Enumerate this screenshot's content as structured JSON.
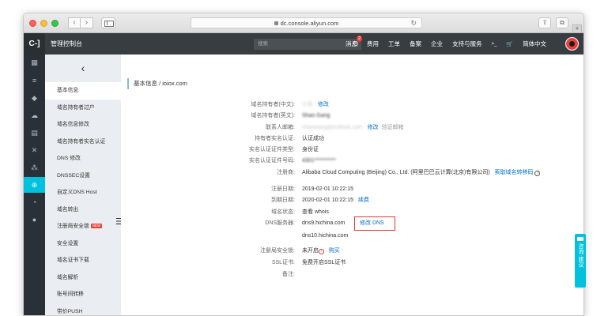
{
  "browser": {
    "url": "dc.console.aliyun.com",
    "back_icon": "‹",
    "forward_icon": "›",
    "reload_icon": "↻",
    "share_icon": "⇧",
    "tabs_icon": "⧉",
    "new_tab_icon": "+"
  },
  "topnav": {
    "logo": "C‑]",
    "title": "管理控制台",
    "search_placeholder": "搜索",
    "items": [
      {
        "label": "消息",
        "badge": "2"
      },
      {
        "label": "费用"
      },
      {
        "label": "工单"
      },
      {
        "label": "备案"
      },
      {
        "label": "企业"
      },
      {
        "label": "支持与服务"
      }
    ],
    "terminal_icon": ">_",
    "cart_icon": "🛒",
    "language": "简体中文"
  },
  "sidebar": {
    "back_icon": "‹",
    "items": [
      {
        "label": "基本信息",
        "active": true
      },
      {
        "label": "域名持有者过户"
      },
      {
        "label": "域名信息修改"
      },
      {
        "label": "域名持有者实名认证"
      },
      {
        "label": "DNS 修改"
      },
      {
        "label": "DNSSEC设置"
      },
      {
        "label": "自定义DNS Host"
      },
      {
        "label": "域名转出"
      },
      {
        "label": "注册局安全锁",
        "tag": "NEW"
      },
      {
        "label": "安全设置"
      },
      {
        "label": "域名证书下载"
      },
      {
        "label": "域名解析"
      },
      {
        "label": "账号间转移"
      },
      {
        "label": "带价PUSH"
      }
    ]
  },
  "breadcrumb": "基本信息 / ioiox.com",
  "details": {
    "owner_cn_label": "域名持有者(中文):",
    "owner_cn_value": "小灰",
    "modify": "修改",
    "owner_en_label": "域名持有者(英文):",
    "owner_en_value": "Shao Gang",
    "email_label": "联系人邮箱:",
    "email_value": "shaoxiang@outlook.com",
    "verify_email": "验证邮箱",
    "realname_label": "持有者实名认证:",
    "realname_value": "认证成功",
    "cert_type_label": "实名认证证件类型:",
    "cert_type_value": "身份证",
    "cert_no_label": "实名认证证件号码:",
    "cert_no_value": "4301**********",
    "registrar_label": "注册商:",
    "registrar_value": "Alibaba Cloud Computing (Beijing) Co., Ltd. (阿里巴巴云计算(北京)有限公司)",
    "auth_code": "索取域名转移码",
    "reg_date_label": "注册日期:",
    "reg_date_value": "2019-02-01 10:22:15",
    "exp_date_label": "到期日期:",
    "exp_date_value": "2020-02-01 10:22:15",
    "renew": "续费",
    "status_label": "域名状态:",
    "status_value": "查看 whois",
    "dns_label": "DNS服务器:",
    "dns1": "dns9.hichina.com",
    "dns2": "dns10.hichina.com",
    "modify_dns": "修改 DNS",
    "lock_label": "注册局安全锁:",
    "lock_value": "未开启",
    "buy": "购买",
    "ssl_label": "SSL证书:",
    "ssl_value": "免费开启SSL证书",
    "note_label": "备注:"
  },
  "consult": "咨询·建议"
}
